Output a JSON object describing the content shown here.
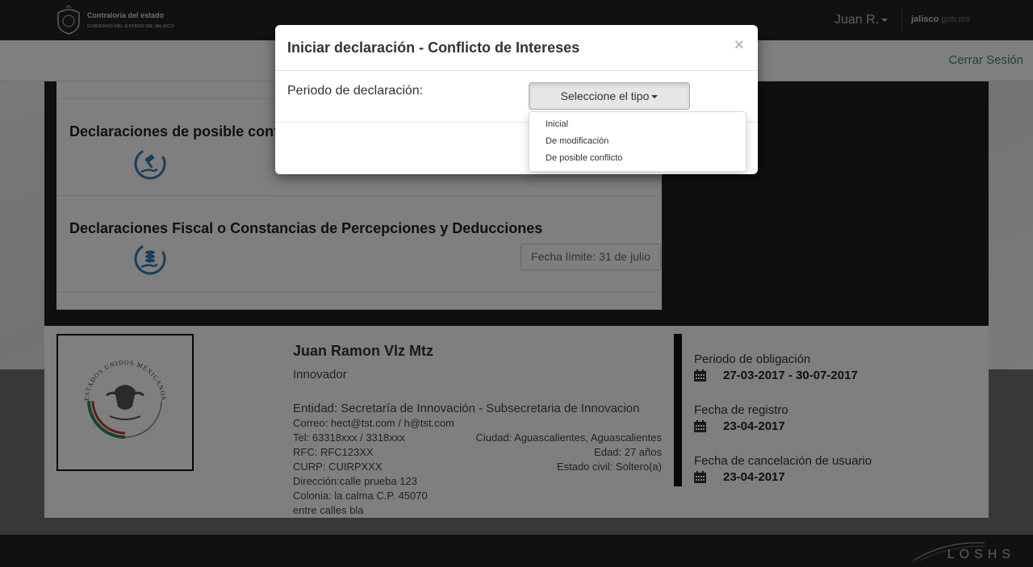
{
  "header": {
    "logo_title": "Contraloría del estado",
    "logo_subtitle": "GOBIERNO DEL ESTADO DE JALISCO",
    "user_name": "Juan R.",
    "brand_bold": "jalisco",
    "brand_light": "gob.mx"
  },
  "subheader": {
    "logout_label": "Cerrar Sesión"
  },
  "sections": [
    {
      "title": "Declaraciones de posible conflicto de intereses",
      "icon": "gavel-hand-icon"
    },
    {
      "title": "Declaraciones Fiscal o Constancias de Percepciones y Deducciones",
      "icon": "coins-hand-icon",
      "deadline": "Fecha límite: 31 de julio"
    }
  ],
  "profile": {
    "name": "Juan Ramon Vlz Mtz",
    "role": "Innovador",
    "entity": "Entidad: Secretaría de Innovación - Subsecretaria de Innovacion",
    "email": "Correo: hect@tst.com / h@tst.com",
    "phone": "Tel: 63318xxx / 3318xxx",
    "rfc": "RFC: RFC123XX",
    "curp": "CURP: CUIRPXXX",
    "address": "Dirección:calle prueba 123",
    "colonia": "Colonia: la calma C.P. 45070",
    "between": "entre calles bla",
    "city": "Ciudad: Aguascalientes, Aguascalientes",
    "age": "Edad: 27 años",
    "civil": "Estado civil: Soltero(a)",
    "seal_text": "ESTADOS UNIDOS MEXICANOS"
  },
  "dates": {
    "period_label": "Periodo de obligación",
    "period_value": "27-03-2017 - 30-07-2017",
    "registration_label": "Fecha de registro",
    "registration_value": "23-04-2017",
    "cancellation_label": "Fecha de cancelación de usuario",
    "cancellation_value": "23-04-2017"
  },
  "footer": {
    "brand": "LOSHS"
  },
  "modal": {
    "title": "Iniciar declaración - Conflicto de Intereses",
    "close": "×",
    "period_label": "Periodo de declaración:",
    "select_label": "Seleccione el tipo",
    "options": [
      "Inicial",
      "De modificación",
      "De posible conflicto"
    ]
  }
}
